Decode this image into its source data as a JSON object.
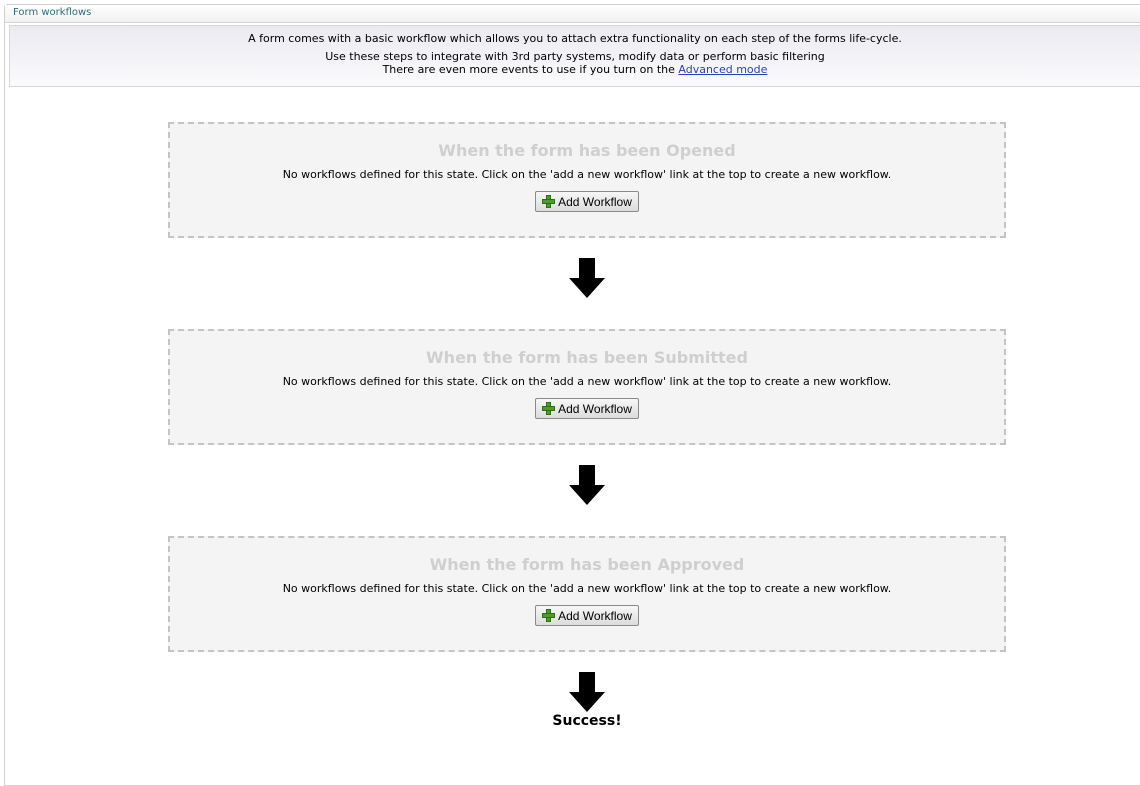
{
  "panel": {
    "title": "Form workflows"
  },
  "intro": {
    "line1": "A form comes with a basic workflow which allows you to attach extra functionality on each step of the forms life-cycle.",
    "line2": "Use these steps to integrate with 3rd party systems, modify data or perform basic filtering",
    "line3": "There are even more events to use if you turn on the",
    "link": "Advanced mode"
  },
  "states": [
    {
      "title": "When the form has been Opened",
      "message": "No workflows defined for this state. Click on the 'add a new workflow' link at the top to create a new workflow.",
      "button": "Add Workflow"
    },
    {
      "title": "When the form has been Submitted",
      "message": "No workflows defined for this state. Click on the 'add a new workflow' link at the top to create a new workflow.",
      "button": "Add Workflow"
    },
    {
      "title": "When the form has been Approved",
      "message": "No workflows defined for this state. Click on the 'add a new workflow' link at the top to create a new workflow.",
      "button": "Add Workflow"
    }
  ],
  "success": "Success!",
  "icons": {
    "button": "plus-icon",
    "flow": "arrow-down-icon"
  }
}
